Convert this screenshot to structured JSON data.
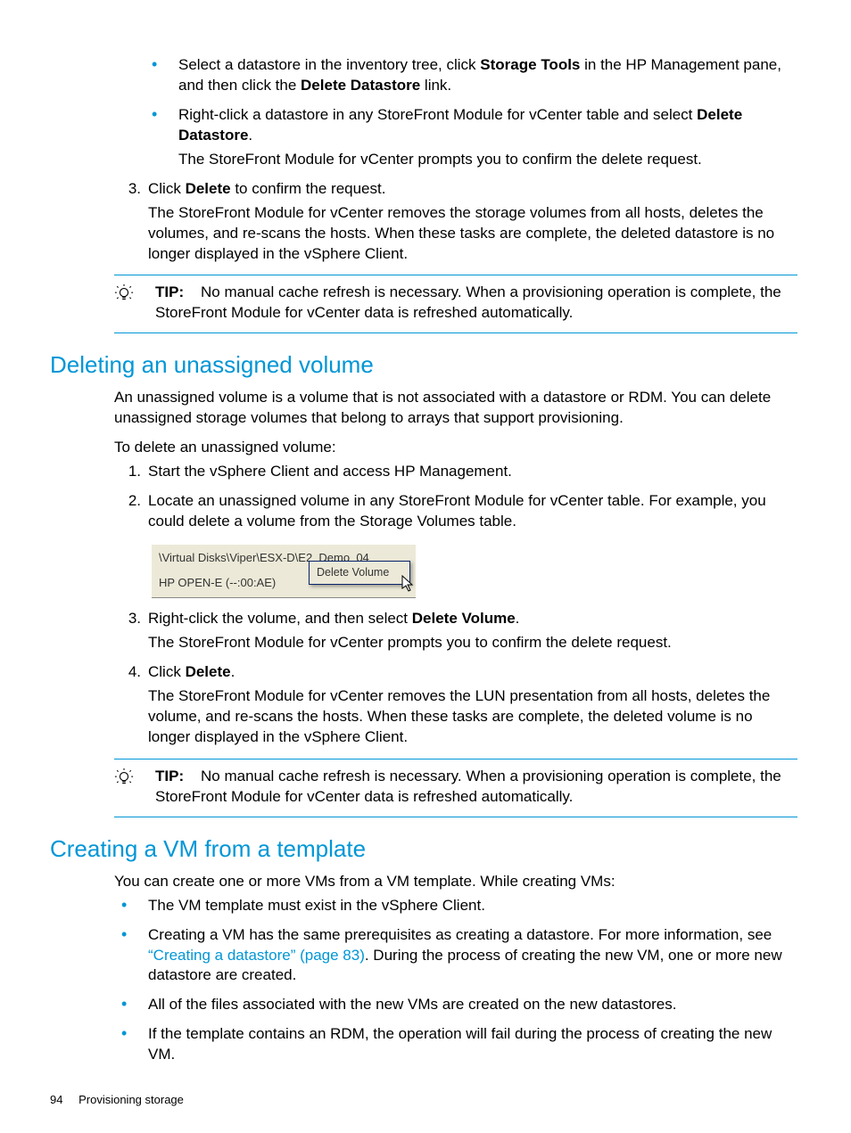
{
  "topBullets": {
    "b1_a": "Select a datastore in the inventory tree, click ",
    "b1_b": "Storage Tools",
    "b1_c": " in the HP Management pane, and then click the ",
    "b1_d": "Delete Datastore",
    "b1_e": " link.",
    "b2_a": "Right-click a datastore in any StoreFront Module for vCenter table and select ",
    "b2_b": "Delete Datastore",
    "b2_c": ".",
    "b2_sub": "The StoreFront Module for vCenter prompts you to confirm the delete request."
  },
  "topStep3": {
    "marker": "3.",
    "a": "Click ",
    "b": "Delete",
    "c": " to confirm the request.",
    "para": "The StoreFront Module for vCenter removes the storage volumes from all hosts, deletes the volumes, and re-scans the hosts. When these tasks are complete, the deleted datastore is no longer displayed in the vSphere Client."
  },
  "tip1": {
    "label": "TIP:",
    "text": "No manual cache refresh is necessary. When a provisioning operation is complete, the StoreFront Module for vCenter data is refreshed automatically."
  },
  "sec1": {
    "title": "Deleting an unassigned volume",
    "p1": "An unassigned volume is a volume that is not associated with a datastore or RDM. You can delete unassigned storage volumes that belong to arrays that support provisioning.",
    "p2": "To delete an unassigned volume:",
    "s1": {
      "marker": "1.",
      "text": "Start the vSphere Client and access HP Management."
    },
    "s2": {
      "marker": "2.",
      "text": "Locate an unassigned volume in any StoreFront Module for vCenter table. For example, you could delete a volume from the Storage Volumes table."
    },
    "fig": {
      "line1": "\\Virtual Disks\\Viper\\ESX-D\\E2_Demo_04",
      "line2": "HP OPEN-E (--:00:AE)",
      "menu": "Delete Volume"
    },
    "s3": {
      "marker": "3.",
      "a": "Right-click the volume, and then select ",
      "b": "Delete Volume",
      "c": ".",
      "para": "The StoreFront Module for vCenter prompts you to confirm the delete request."
    },
    "s4": {
      "marker": "4.",
      "a": "Click ",
      "b": "Delete",
      "c": ".",
      "para": "The StoreFront Module for vCenter removes the LUN presentation from all hosts, deletes the volume, and re-scans the hosts. When these tasks are complete, the deleted volume is no longer displayed in the vSphere Client."
    }
  },
  "tip2": {
    "label": "TIP:",
    "text": "No manual cache refresh is necessary. When a provisioning operation is complete, the StoreFront Module for vCenter data is refreshed automatically."
  },
  "sec2": {
    "title": "Creating a VM from a template",
    "p1": "You can create one or more VMs from a VM template. While creating VMs:",
    "b1": "The VM template must exist in the vSphere Client.",
    "b2_a": "Creating a VM has the same prerequisites as creating a datastore. For more information, see ",
    "b2_link": "“Creating a datastore” (page 83)",
    "b2_b": ". During the process of creating the new VM, one or more new datastore are created.",
    "b3": "All of the files associated with the new VMs are created on the new datastores.",
    "b4": "If the template contains an RDM, the operation will fail during the process of creating the new VM."
  },
  "footer": {
    "page": "94",
    "chapter": "Provisioning storage"
  }
}
